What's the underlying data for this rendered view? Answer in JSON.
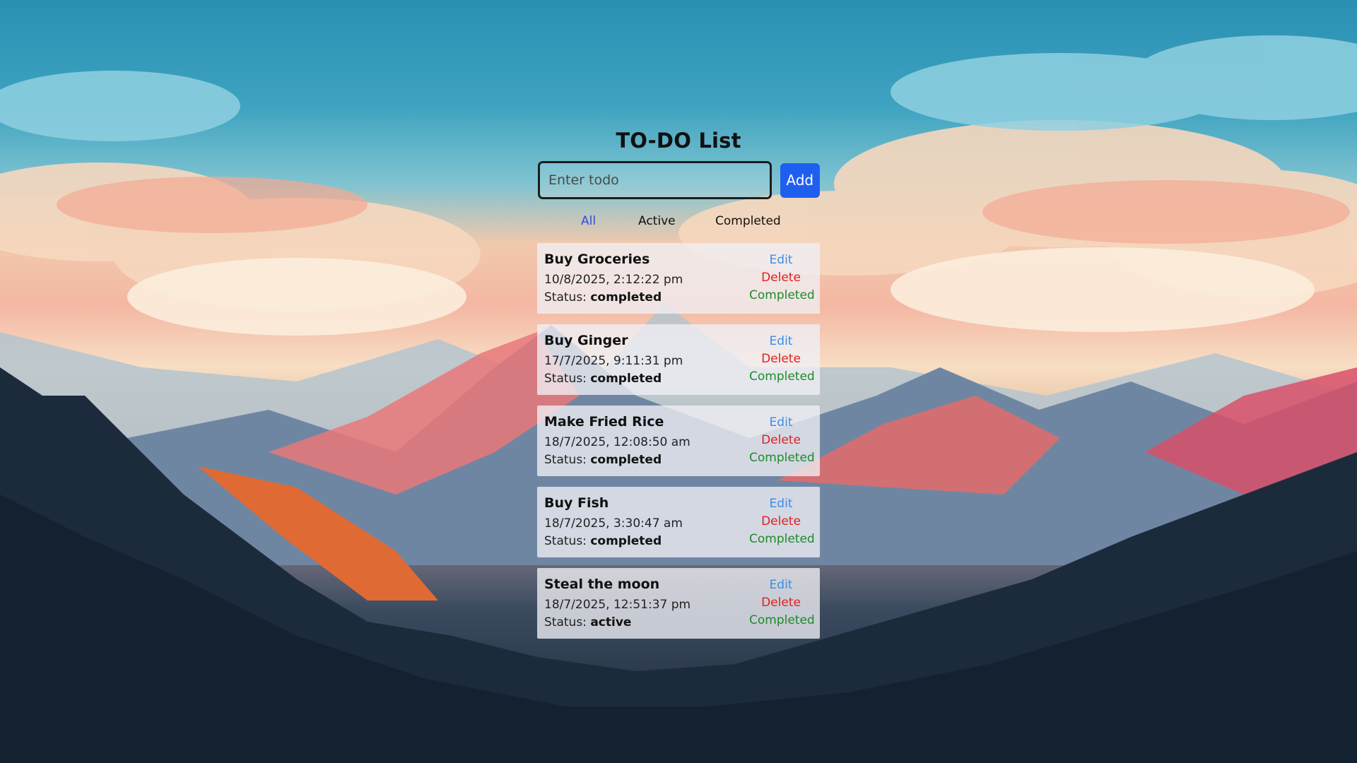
{
  "header": {
    "title": "TO-DO List"
  },
  "new_todo": {
    "placeholder": "Enter todo",
    "value": "",
    "add_label": "Add"
  },
  "filters": [
    {
      "label": "All",
      "active": true
    },
    {
      "label": "Active",
      "active": false
    },
    {
      "label": "Completed",
      "active": false
    }
  ],
  "status_prefix": "Status:",
  "actions": {
    "edit": "Edit",
    "delete": "Delete",
    "complete": "Completed"
  },
  "todos": [
    {
      "title": "Buy Groceries",
      "date": "10/8/2025, 2:12:22 pm",
      "status": "completed"
    },
    {
      "title": "Buy Ginger",
      "date": "17/7/2025, 9:11:31 pm",
      "status": "completed"
    },
    {
      "title": "Make Fried Rice",
      "date": "18/7/2025, 12:08:50 am",
      "status": "completed"
    },
    {
      "title": "Buy Fish",
      "date": "18/7/2025, 3:30:47 am",
      "status": "completed"
    },
    {
      "title": "Steal the moon",
      "date": "18/7/2025, 12:51:37 pm",
      "status": "active"
    }
  ],
  "colors": {
    "accent": "#1f5ff0",
    "filter_active": "#2d4ed8",
    "edit": "#3a8ee6",
    "delete": "#e02020",
    "complete": "#1f8a2a"
  }
}
